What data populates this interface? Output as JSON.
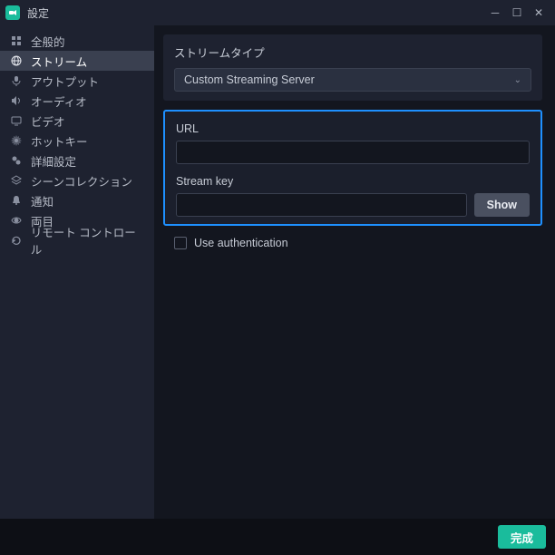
{
  "titlebar": {
    "title": "設定"
  },
  "sidebar": {
    "items": [
      {
        "label": "全般的"
      },
      {
        "label": "ストリーム"
      },
      {
        "label": "アウトプット"
      },
      {
        "label": "オーディオ"
      },
      {
        "label": "ビデオ"
      },
      {
        "label": "ホットキー"
      },
      {
        "label": "詳細設定"
      },
      {
        "label": "シーンコレクション"
      },
      {
        "label": "通知"
      },
      {
        "label": "両目"
      },
      {
        "label": "リモート コントロール"
      }
    ]
  },
  "content": {
    "stream_type_label": "ストリームタイプ",
    "stream_type_value": "Custom Streaming Server",
    "url_label": "URL",
    "url_value": "",
    "stream_key_label": "Stream key",
    "stream_key_value": "",
    "show_button": "Show",
    "use_auth_label": "Use authentication"
  },
  "footer": {
    "done": "完成"
  }
}
